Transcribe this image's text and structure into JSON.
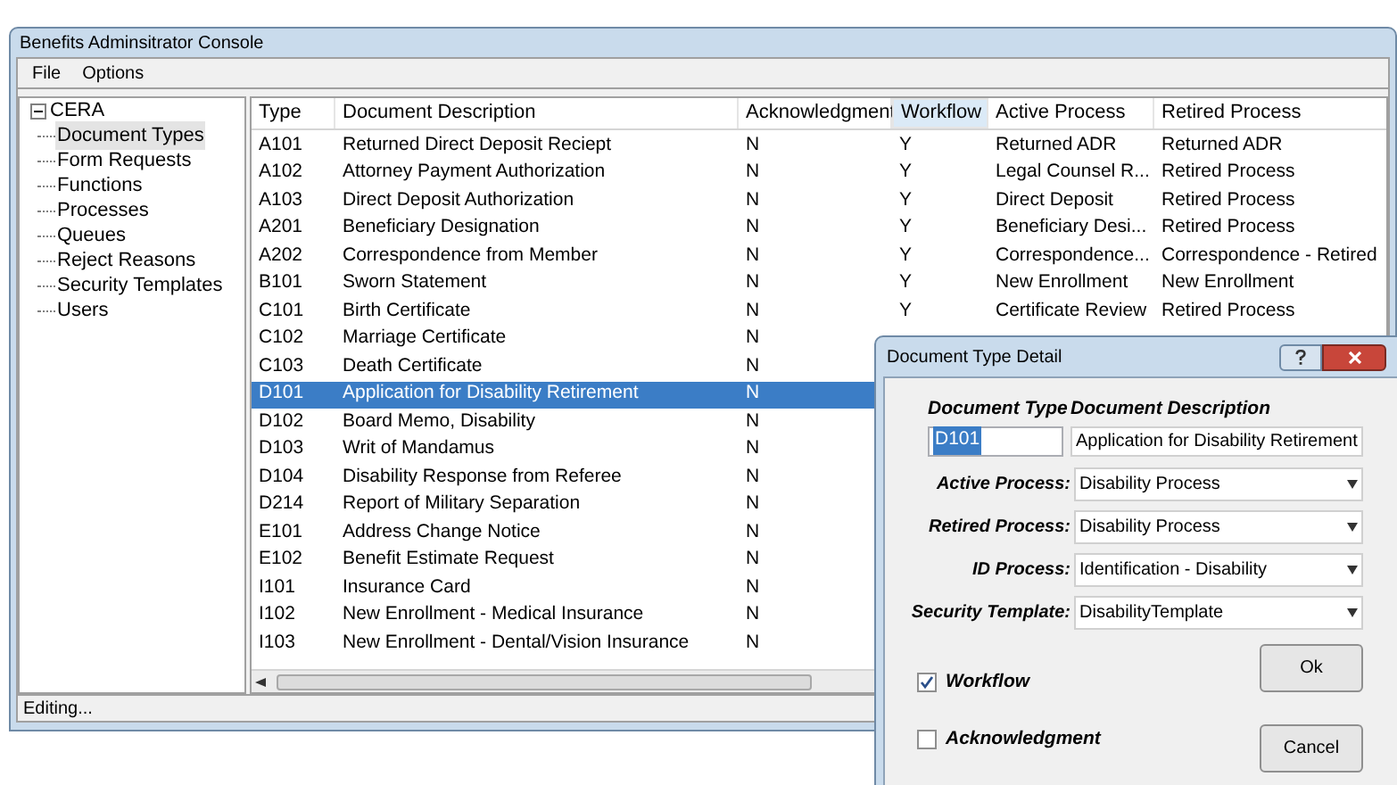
{
  "window": {
    "title": "Benefits Adminsitrator Console"
  },
  "menu": [
    "File",
    "Options"
  ],
  "tree": {
    "label": "CERA",
    "expanded": true,
    "children": [
      {
        "label": "Document Types",
        "selected": true
      },
      {
        "label": "Form Requests",
        "selected": false
      },
      {
        "label": "Functions",
        "selected": false
      },
      {
        "label": "Processes",
        "selected": false
      },
      {
        "label": "Queues",
        "selected": false
      },
      {
        "label": "Reject Reasons",
        "selected": false
      },
      {
        "label": "Security Templates",
        "selected": false
      },
      {
        "label": "Users",
        "selected": false
      }
    ]
  },
  "table": {
    "columns": [
      {
        "label": "Type",
        "selected": false
      },
      {
        "label": "Document Description",
        "selected": false
      },
      {
        "label": "Acknowledgment",
        "selected": false
      },
      {
        "label": "Workflow",
        "selected": true
      },
      {
        "label": "Active Process",
        "selected": false
      },
      {
        "label": "Retired Process",
        "selected": false
      }
    ],
    "rows": [
      {
        "selected": false,
        "cells": [
          "A101",
          "Returned Direct Deposit Reciept",
          "N",
          "Y",
          "Returned ADR",
          "Returned ADR"
        ]
      },
      {
        "selected": false,
        "cells": [
          "A102",
          "Attorney Payment Authorization",
          "N",
          "Y",
          "Legal Counsel R...",
          "Retired Process"
        ]
      },
      {
        "selected": false,
        "cells": [
          "A103",
          "Direct Deposit Authorization",
          "N",
          "Y",
          "Direct Deposit",
          "Retired Process"
        ]
      },
      {
        "selected": false,
        "cells": [
          "A201",
          "Beneficiary Designation",
          "N",
          "Y",
          "Beneficiary Desi...",
          "Retired Process"
        ]
      },
      {
        "selected": false,
        "cells": [
          "A202",
          "Correspondence from Member",
          "N",
          "Y",
          "Correspondence...",
          "Correspondence - Retired"
        ]
      },
      {
        "selected": false,
        "cells": [
          "B101",
          "Sworn Statement",
          "N",
          "Y",
          "New Enrollment",
          "New Enrollment"
        ]
      },
      {
        "selected": false,
        "cells": [
          "C101",
          "Birth Certificate",
          "N",
          "Y",
          "Certificate Review",
          "Retired Process"
        ]
      },
      {
        "selected": false,
        "cells": [
          "C102",
          "Marriage Certificate",
          "N"
        ]
      },
      {
        "selected": false,
        "cells": [
          "C103",
          "Death Certificate",
          "N"
        ]
      },
      {
        "selected": true,
        "cells": [
          "D101",
          "Application for Disability Retirement",
          "N"
        ]
      },
      {
        "selected": false,
        "cells": [
          "D102",
          "Board Memo, Disability",
          "N"
        ]
      },
      {
        "selected": false,
        "cells": [
          "D103",
          "Writ of Mandamus",
          "N"
        ]
      },
      {
        "selected": false,
        "cells": [
          "D104",
          "Disability Response from Referee",
          "N"
        ]
      },
      {
        "selected": false,
        "cells": [
          "D214",
          "Report of Military Separation",
          "N"
        ]
      },
      {
        "selected": false,
        "cells": [
          "E101",
          "Address Change Notice",
          "N"
        ]
      },
      {
        "selected": false,
        "cells": [
          "E102",
          "Benefit Estimate Request",
          "N"
        ]
      },
      {
        "selected": false,
        "cells": [
          "I101",
          "Insurance Card",
          "N"
        ]
      },
      {
        "selected": false,
        "cells": [
          "I102",
          "New Enrollment - Medical Insurance",
          "N"
        ]
      },
      {
        "selected": false,
        "cells": [
          "I103",
          "New Enrollment - Dental/Vision Insurance",
          "N"
        ]
      }
    ]
  },
  "status_bar": "Editing...",
  "dialog": {
    "title": "Document Type Detail",
    "type_label": "Document Type",
    "type_value": "D101",
    "description_label": "Document Description",
    "description_value": "Application for Disability Retirement",
    "selects": [
      {
        "label": "Active Process:",
        "value": "Disability Process"
      },
      {
        "label": "Retired Process:",
        "value": "Disability Process"
      },
      {
        "label": "ID Process:",
        "value": "Identification - Disability"
      },
      {
        "label": "Security Template:",
        "value": "DisabilityTemplate"
      }
    ],
    "checkboxes": [
      {
        "label": "Workflow",
        "checked": true
      },
      {
        "label": "Acknowledgment",
        "checked": false
      }
    ],
    "buttons": [
      "Ok",
      "Cancel"
    ]
  }
}
